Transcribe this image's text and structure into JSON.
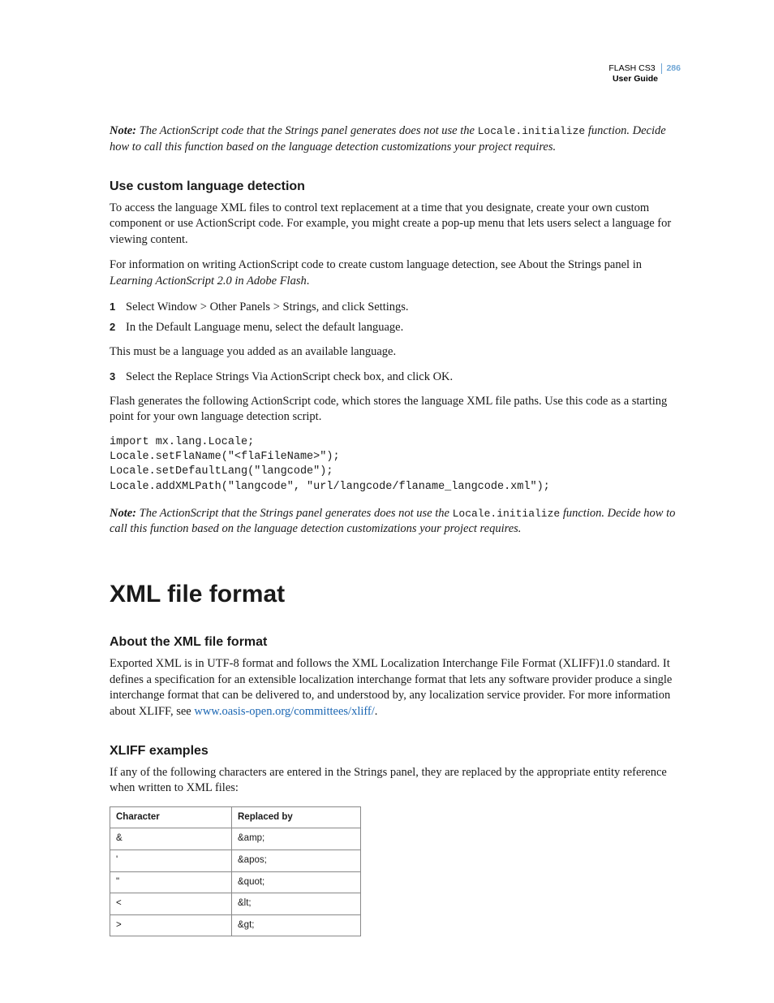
{
  "header": {
    "product": "FLASH CS3",
    "page_number": "286",
    "subtitle": "User Guide"
  },
  "note1": {
    "label": "Note:",
    "part1": "The ActionScript code that the Strings panel generates does not use the ",
    "code": "Locale.initialize",
    "part2": " function. Decide how to call this function based on the language detection customizations your project requires."
  },
  "section1": {
    "heading": "Use custom language detection",
    "p1": "To access the language XML files to control text replacement at a time that you designate, create your own custom component or use ActionScript code. For example, you might create a pop-up menu that lets users select a language for viewing content.",
    "p2a": "For information on writing ActionScript code to create custom language detection, see About the Strings panel in ",
    "p2b": "Learning ActionScript 2.0 in Adobe Flash",
    "p2c": ".",
    "steps": [
      {
        "n": "1",
        "t": "Select Window > Other Panels > Strings, and click Settings."
      },
      {
        "n": "2",
        "t": "In the Default Language menu, select the default language."
      }
    ],
    "p3": "This must be a language you added as an available language.",
    "steps2": [
      {
        "n": "3",
        "t": "Select the Replace Strings Via ActionScript check box, and click OK."
      }
    ],
    "p4": "Flash generates the following ActionScript code, which stores the language XML file paths. Use this code as a starting point for your own language detection script.",
    "code": "import mx.lang.Locale;\nLocale.setFlaName(\"<flaFileName>\");\nLocale.setDefaultLang(\"langcode\");\nLocale.addXMLPath(\"langcode\", \"url/langcode/flaname_langcode.xml\");"
  },
  "note2": {
    "label": "Note:",
    "part1": "The ActionScript that the Strings panel generates does not use the ",
    "code": "Locale.initialize",
    "part2": " function. Decide how to call this function based on the language detection customizations your project requires."
  },
  "section2": {
    "heading": "XML file format",
    "sub1": {
      "heading": "About the XML file format",
      "p1a": "Exported XML is in UTF-8 format and follows the XML Localization Interchange File Format (XLIFF)1.0 standard. It defines a specification for an extensible localization interchange format that lets any software provider produce a single interchange format that can be delivered to, and understood by, any localization service provider. For more information about XLIFF, see ",
      "link": "www.oasis-open.org/committees/xliff/",
      "p1b": "."
    },
    "sub2": {
      "heading": "XLIFF examples",
      "p1": "If any of the following characters are entered in the Strings panel, they are replaced by the appropriate entity reference when written to XML files:",
      "table": {
        "headers": [
          "Character",
          "Replaced by"
        ],
        "rows": [
          [
            "&",
            "&amp;"
          ],
          [
            "'",
            "&apos;"
          ],
          [
            "\"",
            "&quot;"
          ],
          [
            "<",
            "&lt;"
          ],
          [
            ">",
            "&gt;"
          ]
        ]
      }
    }
  }
}
